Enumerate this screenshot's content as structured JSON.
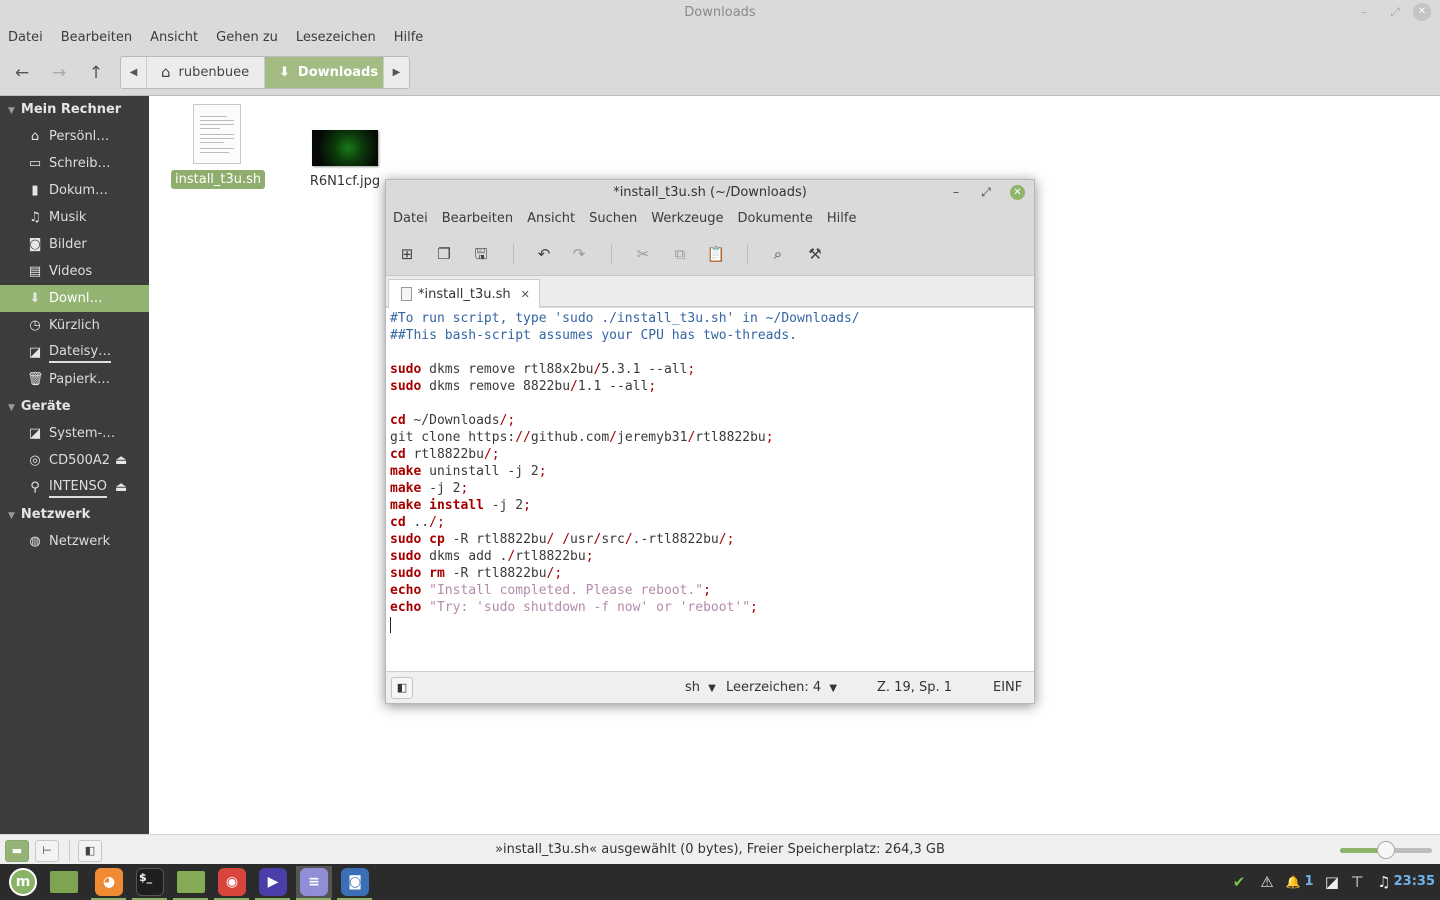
{
  "file_manager": {
    "window_title": "Downloads",
    "window_controls": {
      "minimize": "–",
      "maximize": "⤢",
      "close": "✕"
    },
    "menu": [
      "Datei",
      "Bearbeiten",
      "Ansicht",
      "Gehen zu",
      "Lesezeichen",
      "Hilfe"
    ],
    "nav": {
      "back_icon": "←",
      "forward_icon": "→",
      "up_icon": "↑"
    },
    "pathbar": {
      "left_arrow": "◀",
      "right_arrow": "▶",
      "segments": [
        {
          "label": "rubenbuee",
          "icon": "⌂"
        },
        {
          "label": "Downloads",
          "icon": "⬇"
        }
      ]
    },
    "toolbar_right": {
      "location_toggle_icon": "↵",
      "search_icon": "⌕",
      "icon_view_icon": "▦",
      "list_view_icon": "☰",
      "compact_view_icon": "⋮⋮"
    },
    "sidebar": {
      "sections": [
        {
          "title": "Mein Rechner",
          "items": [
            {
              "label": "Persönl…",
              "icon": "⌂"
            },
            {
              "label": "Schreib…",
              "icon": "▭"
            },
            {
              "label": "Dokum…",
              "icon": "▮"
            },
            {
              "label": "Musik",
              "icon": "♫"
            },
            {
              "label": "Bilder",
              "icon": "◙"
            },
            {
              "label": "Videos",
              "icon": "▤"
            },
            {
              "label": "Downl…",
              "icon": "⬇"
            },
            {
              "label": "Kürzlich",
              "icon": "◷"
            },
            {
              "label": "Dateisy…",
              "icon": "◪"
            },
            {
              "label": "Papierk…",
              "icon": "🗑"
            }
          ]
        },
        {
          "title": "Geräte",
          "items": [
            {
              "label": "System-…",
              "icon": "◪"
            },
            {
              "label": "CD500A2",
              "icon": "◎",
              "eject": "⏏"
            },
            {
              "label": "INTENSO",
              "icon": "⚲",
              "eject": "⏏"
            }
          ]
        },
        {
          "title": "Netzwerk",
          "items": [
            {
              "label": "Netzwerk",
              "icon": "◍"
            }
          ]
        }
      ]
    },
    "files": [
      {
        "name": "install_t3u.sh",
        "type": "text",
        "selected": true
      },
      {
        "name": "R6N1cf.jpg",
        "type": "image",
        "selected": false
      }
    ],
    "statusbar": {
      "text": "»install_t3u.sh« ausgewählt (0 bytes), Freier Speicherplatz: 264,3 GB",
      "places_icon": "▬",
      "tree_icon": "⊢",
      "toggle_sidebar_icon": "◧",
      "zoom_level": 0.5
    }
  },
  "editor": {
    "window_title": "*install_t3u.sh (~/Downloads)",
    "window_controls": {
      "minimize": "–",
      "maximize": "⤢",
      "close": "✕"
    },
    "menu": [
      "Datei",
      "Bearbeiten",
      "Ansicht",
      "Suchen",
      "Werkzeuge",
      "Dokumente",
      "Hilfe"
    ],
    "toolbar": {
      "new": "⊞",
      "open": "❐",
      "save": "🖫",
      "undo": "↶",
      "redo": "↷",
      "cut": "✂",
      "copy": "⧉",
      "paste": "📋",
      "find": "⌕",
      "replace": "⚒"
    },
    "tab": {
      "label": "*install_t3u.sh",
      "close": "✕"
    },
    "code_lines": [
      [
        {
          "t": "cm",
          "v": "#To run script, type 'sudo ./install_t3u.sh' in ~/Downloads/"
        }
      ],
      [
        {
          "t": "cm",
          "v": "##This bash-script assumes your CPU has two-threads."
        }
      ],
      [],
      [
        {
          "t": "kw",
          "v": "sudo"
        },
        {
          "t": "",
          "v": " dkms remove rtl88x2bu"
        },
        {
          "t": "op",
          "v": "/"
        },
        {
          "t": "",
          "v": "5.3.1 --all"
        },
        {
          "t": "op",
          "v": ";"
        }
      ],
      [
        {
          "t": "kw",
          "v": "sudo"
        },
        {
          "t": "",
          "v": " dkms remove 8822bu"
        },
        {
          "t": "op",
          "v": "/"
        },
        {
          "t": "",
          "v": "1.1 --all"
        },
        {
          "t": "op",
          "v": ";"
        }
      ],
      [],
      [
        {
          "t": "kw",
          "v": "cd"
        },
        {
          "t": "",
          "v": " ~/Downloads"
        },
        {
          "t": "op",
          "v": "/;"
        }
      ],
      [
        {
          "t": "",
          "v": "git clone https:"
        },
        {
          "t": "op",
          "v": "//"
        },
        {
          "t": "",
          "v": "github.com"
        },
        {
          "t": "op",
          "v": "/"
        },
        {
          "t": "",
          "v": "jeremyb31"
        },
        {
          "t": "op",
          "v": "/"
        },
        {
          "t": "",
          "v": "rtl8822bu"
        },
        {
          "t": "op",
          "v": ";"
        }
      ],
      [
        {
          "t": "kw",
          "v": "cd"
        },
        {
          "t": "",
          "v": " rtl8822bu"
        },
        {
          "t": "op",
          "v": "/;"
        }
      ],
      [
        {
          "t": "kw",
          "v": "make"
        },
        {
          "t": "",
          "v": " uninstall -j 2"
        },
        {
          "t": "op",
          "v": ";"
        }
      ],
      [
        {
          "t": "kw",
          "v": "make"
        },
        {
          "t": "",
          "v": " -j 2"
        },
        {
          "t": "op",
          "v": ";"
        }
      ],
      [
        {
          "t": "kw",
          "v": "make install"
        },
        {
          "t": "",
          "v": " -j 2"
        },
        {
          "t": "op",
          "v": ";"
        }
      ],
      [
        {
          "t": "kw",
          "v": "cd"
        },
        {
          "t": "",
          "v": " .."
        },
        {
          "t": "op",
          "v": "/;"
        }
      ],
      [
        {
          "t": "kw",
          "v": "sudo cp"
        },
        {
          "t": "",
          "v": " -R rtl8822bu"
        },
        {
          "t": "op",
          "v": "/ /"
        },
        {
          "t": "",
          "v": "usr"
        },
        {
          "t": "op",
          "v": "/"
        },
        {
          "t": "",
          "v": "src"
        },
        {
          "t": "op",
          "v": "/"
        },
        {
          "t": "",
          "v": ".-rtl8822bu"
        },
        {
          "t": "op",
          "v": "/;"
        }
      ],
      [
        {
          "t": "kw",
          "v": "sudo"
        },
        {
          "t": "",
          "v": " dkms add ."
        },
        {
          "t": "op",
          "v": "/"
        },
        {
          "t": "",
          "v": "rtl8822bu"
        },
        {
          "t": "op",
          "v": ";"
        }
      ],
      [
        {
          "t": "kw",
          "v": "sudo rm"
        },
        {
          "t": "",
          "v": " -R rtl8822bu"
        },
        {
          "t": "op",
          "v": "/;"
        }
      ],
      [
        {
          "t": "kw",
          "v": "echo"
        },
        {
          "t": "",
          "v": " "
        },
        {
          "t": "str",
          "v": "\"Install completed. Please reboot.\""
        },
        {
          "t": "op",
          "v": ";"
        }
      ],
      [
        {
          "t": "kw",
          "v": "echo"
        },
        {
          "t": "",
          "v": " "
        },
        {
          "t": "str",
          "v": "\"Try: 'sudo shutdown -f now' or 'reboot'\""
        },
        {
          "t": "op",
          "v": ";"
        }
      ],
      [
        {
          "t": "cursor",
          "v": ""
        }
      ]
    ],
    "statusbar": {
      "side_panel_icon": "◧",
      "language": "sh",
      "indent": "Leerzeichen: 4",
      "dropdown_icon": "▼",
      "position": "Z. 19, Sp. 1",
      "mode": "EINF"
    }
  },
  "taskbar": {
    "apps": [
      {
        "name": "menu",
        "icon": "m",
        "color": "#8ab465"
      },
      {
        "name": "show-desktop",
        "icon": "",
        "color": "#7ea452"
      },
      {
        "name": "firefox",
        "icon": "◕",
        "color": "#f08a33"
      },
      {
        "name": "terminal",
        "icon": "$_",
        "color": "#1e1e1e"
      },
      {
        "name": "files",
        "icon": "",
        "color": "#86ab55"
      },
      {
        "name": "chrome",
        "icon": "◉",
        "color": "#d8453c"
      },
      {
        "name": "media-player",
        "icon": "▶",
        "color": "#4a3ea8"
      },
      {
        "name": "text-editor",
        "icon": "≡",
        "color": "#8f8ed6"
      },
      {
        "name": "screenshot",
        "icon": "◙",
        "color": "#3b6fb5"
      }
    ],
    "tray": {
      "shield_icon": "✔",
      "warning_icon": "⚠",
      "notifications_icon": "🔔",
      "notifications_count": "1",
      "drive_icon": "◪",
      "network_icon": "⊤",
      "sound_icon": "♫",
      "clock": "23:35"
    }
  }
}
